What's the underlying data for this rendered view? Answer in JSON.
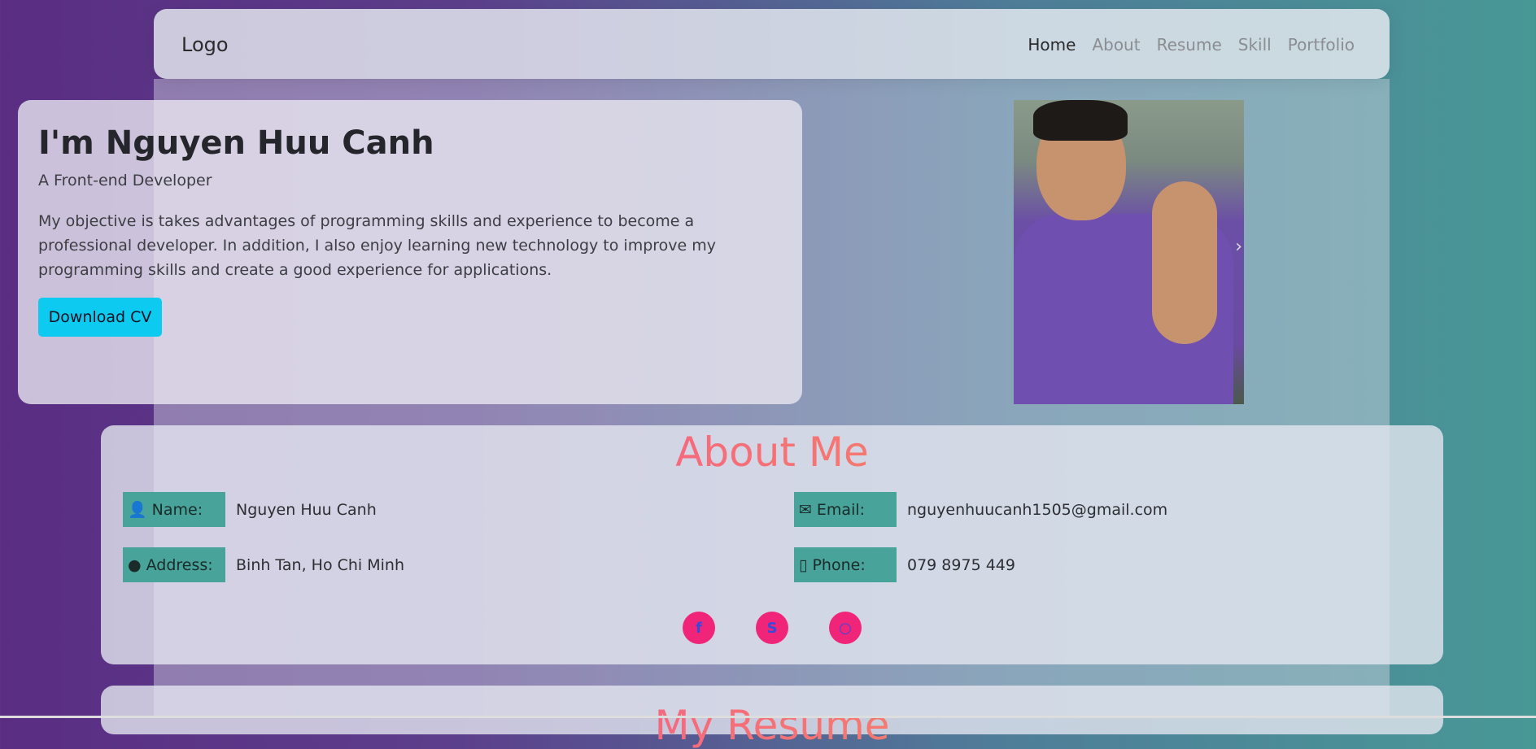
{
  "navbar": {
    "logo": "Logo",
    "items": [
      {
        "label": "Home",
        "active": true
      },
      {
        "label": "About",
        "active": false
      },
      {
        "label": "Resume",
        "active": false
      },
      {
        "label": "Skill",
        "active": false
      },
      {
        "label": "Portfolio",
        "active": false
      }
    ]
  },
  "hero": {
    "title": "I'm Nguyen Huu Canh",
    "subtitle": "A Front-end Developer",
    "description": "My objective is takes advantages of programming skills and experience to become a professional developer. In addition, I also enjoy learning new technology to improve my programming skills and create a good experience for applications.",
    "download_button": "Download CV"
  },
  "about": {
    "title": "About Me",
    "fields": {
      "name": {
        "label": "Name:",
        "value": "Nguyen Huu Canh",
        "icon": "user-icon"
      },
      "email": {
        "label": "Email:",
        "value": "nguyenhuucanh1505@gmail.com",
        "icon": "envelope-icon"
      },
      "address": {
        "label": "Address:",
        "value": "Binh Tan, Ho Chi Minh",
        "icon": "map-marker-icon"
      },
      "phone": {
        "label": "Phone:",
        "value": "079 8975 449",
        "icon": "mobile-icon"
      }
    },
    "socials": [
      "facebook-icon",
      "skype-icon",
      "github-icon"
    ]
  },
  "resume": {
    "title": "My Resume"
  },
  "colors": {
    "accent_cyan": "#0dcaf0",
    "label_teal": "#48a39a",
    "social_pink": "#f0257a"
  }
}
